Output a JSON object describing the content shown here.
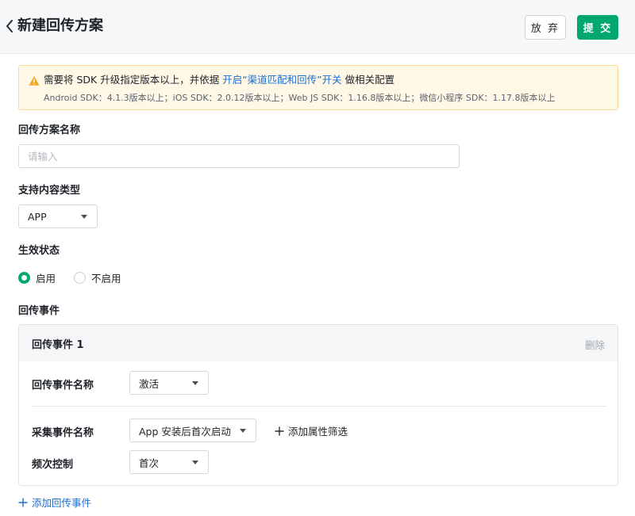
{
  "header": {
    "title": "新建回传方案",
    "back_icon": "chevron-left-icon",
    "discard_label": "放 弃",
    "submit_label": "提 交",
    "accent_color": "#00a870"
  },
  "notice": {
    "icon": "warning-triangle-icon",
    "text_before": "需要将 SDK 升级指定版本以上，并依据 ",
    "link_text": "开启“渠道匹配和回传”开关",
    "text_after": " 做相关配置",
    "versions": "Android SDK：4.1.3版本以上；iOS SDK：2.0.12版本以上；Web JS SDK：1.16.8版本以上；微信小程序 SDK：1.17.8版本以上"
  },
  "form": {
    "name_label": "回传方案名称",
    "name_placeholder": "请输入",
    "name_value": "",
    "content_type_label": "支持内容类型",
    "content_type_value": "APP",
    "status_label": "生效状态",
    "status_options": [
      {
        "label": "启用",
        "selected": true
      },
      {
        "label": "不启用",
        "selected": false
      }
    ],
    "events_label": "回传事件"
  },
  "event_card": {
    "title": "回传事件 1",
    "delete_label": "删除",
    "callback_event_label": "回传事件名称",
    "callback_event_value": "激活",
    "collect_event_label": "采集事件名称",
    "collect_event_value": "App 安装后首次启动",
    "add_filter_label": "添加属性筛选",
    "frequency_label": "频次控制",
    "frequency_value": "首次"
  },
  "add_event_label": "添加回传事件"
}
